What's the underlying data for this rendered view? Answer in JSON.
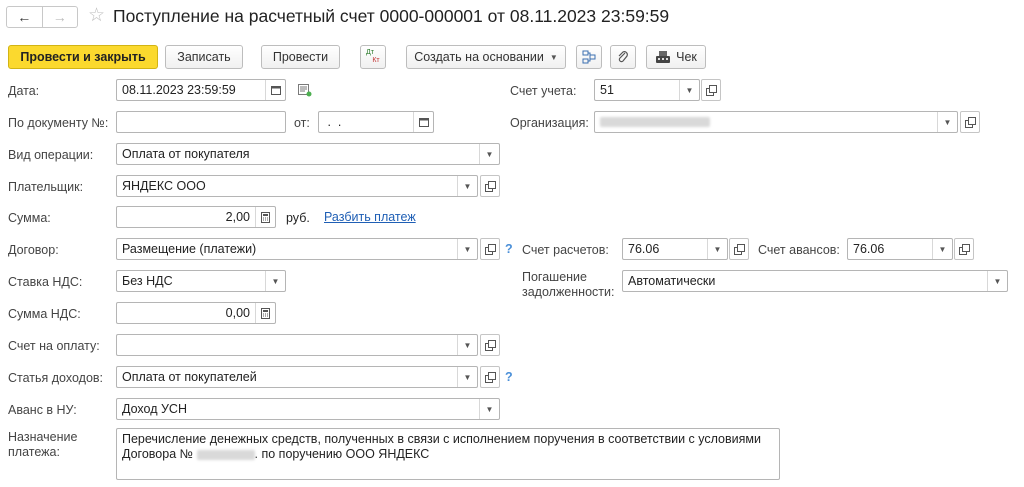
{
  "title": "Поступление на расчетный счет 0000-000001 от 08.11.2023 23:59:59",
  "toolbar": {
    "post_close": "Провести и закрыть",
    "save": "Записать",
    "post": "Провести",
    "dt_kt_top": "Дт",
    "dt_kt_bottom": "Кт",
    "create_based": "Создать на основании",
    "check": "Чек"
  },
  "fields": {
    "date": {
      "label": "Дата:",
      "value": "08.11.2023 23:59:59"
    },
    "doc_number": {
      "label": "По документу №:",
      "value": ""
    },
    "from": {
      "label": "от:",
      "value": " .  ."
    },
    "operation": {
      "label": "Вид операции:",
      "value": "Оплата от покупателя"
    },
    "payer": {
      "label": "Плательщик:",
      "value": "ЯНДЕКС ООО"
    },
    "sum": {
      "label": "Сумма:",
      "value": "2,00",
      "currency": "руб.",
      "split_link": "Разбить платеж"
    },
    "contract": {
      "label": "Договор:",
      "value": "Размещение (платежи)"
    },
    "vat_rate": {
      "label": "Ставка НДС:",
      "value": "Без НДС"
    },
    "vat_sum": {
      "label": "Сумма НДС:",
      "value": "0,00"
    },
    "invoice": {
      "label": "Счет на оплату:",
      "value": ""
    },
    "income_item": {
      "label": "Статья доходов:",
      "value": "Оплата от покупателей"
    },
    "advance_nu": {
      "label": "Аванс в НУ:",
      "value": "Доход УСН"
    },
    "purpose": {
      "label_line1": "Назначение",
      "label_line2": "платежа:",
      "line1": "Перечисление денежных средств, полученных в связи с исполнением поручения в соответствии с условиями",
      "line2_prefix": "Договора №",
      "line2_suffix": ". по поручению ООО ЯНДЕКС"
    },
    "account": {
      "label": "Счет учета:",
      "value": "51"
    },
    "organization": {
      "label": "Организация:",
      "value": ""
    },
    "settlement_account": {
      "label": "Счет расчетов:",
      "value": "76.06"
    },
    "advance_account": {
      "label": "Счет авансов:",
      "value": "76.06"
    },
    "debt_repayment": {
      "label_line1": "Погашение",
      "label_line2": "задолженности:",
      "value": "Автоматически"
    }
  },
  "help_mark": "?",
  "colors": {
    "primary_button": "#fbd92e",
    "link": "#1f5fb5",
    "help": "#4a8fd8"
  }
}
